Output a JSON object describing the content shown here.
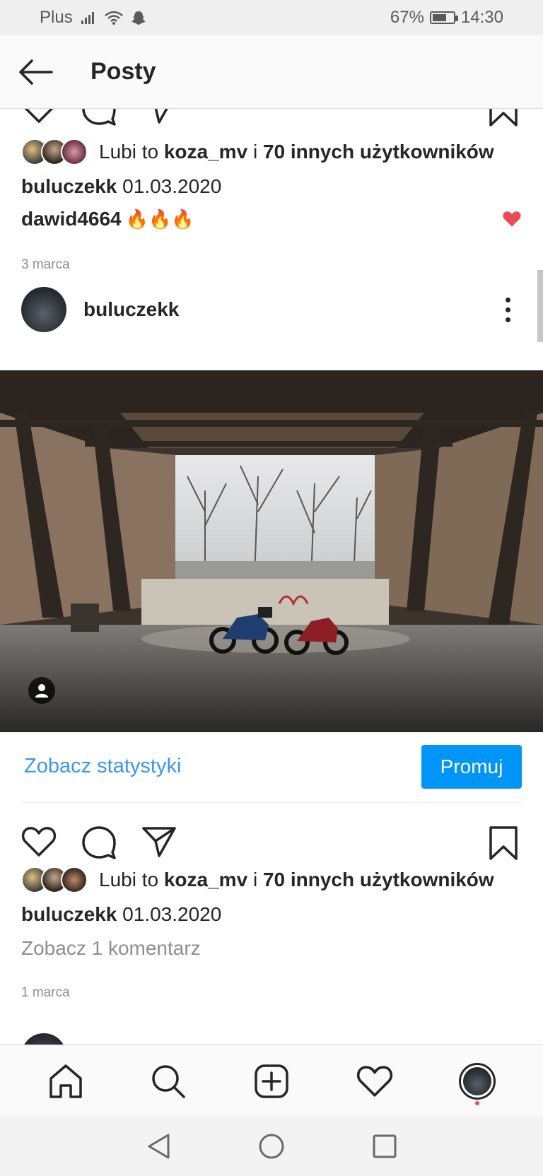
{
  "status_bar": {
    "carrier": "Plus",
    "battery": "67%",
    "battery_level": 0.67,
    "time": "14:30"
  },
  "header": {
    "title": "Posty"
  },
  "post1": {
    "likes_prefix": "Lubi to",
    "likes_user": "koza_mv",
    "likes_join": "i",
    "likes_others": "70 innych użytkowników",
    "caption_user": "buluczekk",
    "caption_text": "01.03.2020",
    "comment_user": "dawid4664",
    "comment_text": "🔥🔥🔥",
    "date": "3 marca"
  },
  "post2": {
    "username": "buluczekk",
    "insights_label": "Zobacz statystyki",
    "promote_label": "Promuj",
    "likes_prefix": "Lubi to",
    "likes_user": "koza_mv",
    "likes_join": "i",
    "likes_others": "70 innych użytkowników",
    "caption_user": "buluczekk",
    "caption_text": "01.03.2020",
    "view_comments": "Zobacz 1 komentarz",
    "date": "1 marca"
  },
  "colors": {
    "accent": "#0095f6",
    "link": "#3897f0",
    "like_red": "#ed4956"
  },
  "bottom_nav": [
    "home-icon",
    "search-icon",
    "add-post-icon",
    "activity-heart-icon",
    "profile-avatar"
  ],
  "android_nav": [
    "back-triangle-icon",
    "home-circle-icon",
    "recents-square-icon"
  ]
}
